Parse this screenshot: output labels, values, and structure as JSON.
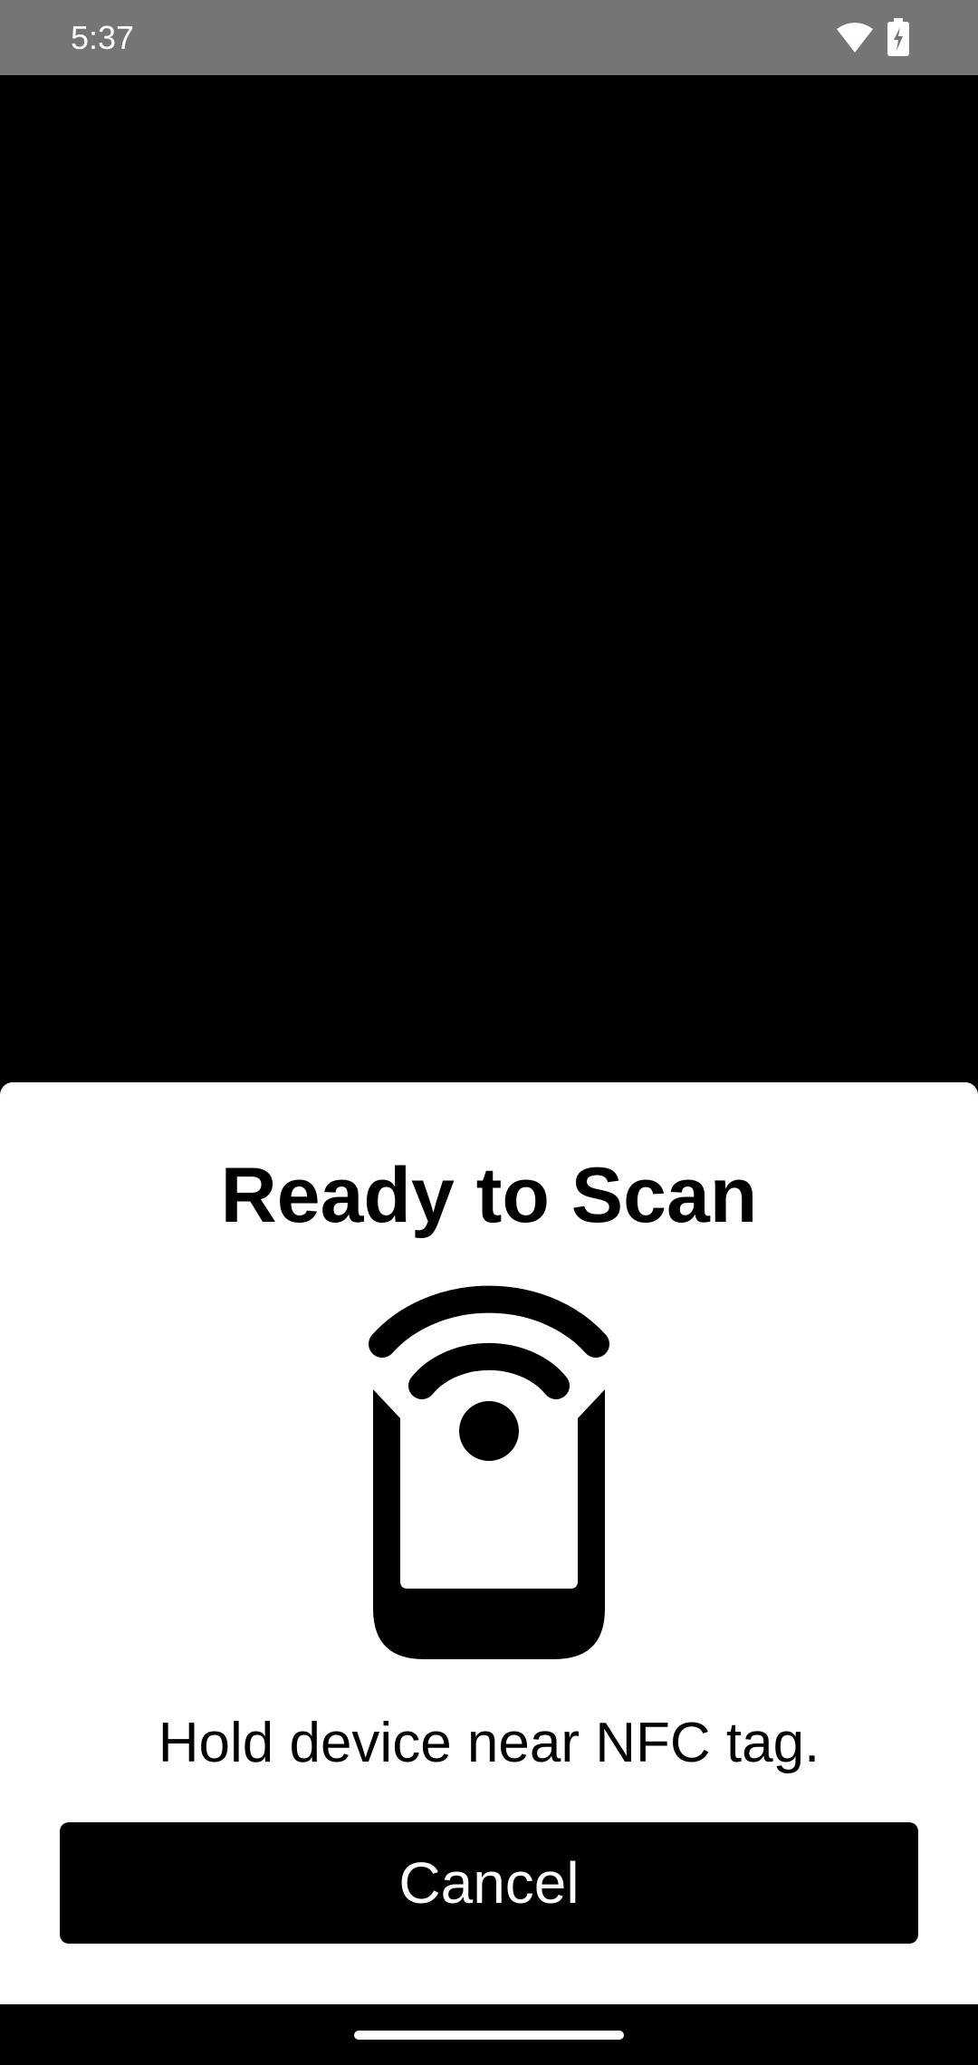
{
  "status_bar": {
    "time": "5:37",
    "icons": [
      "wifi-icon",
      "battery-charging-icon"
    ]
  },
  "sheet": {
    "title": "Ready to Scan",
    "icon": "nfc-phone-icon",
    "message": "Hold device near NFC tag.",
    "cancel_label": "Cancel"
  },
  "colors": {
    "status_bar_bg": "#757575",
    "app_bg": "#000000",
    "sheet_bg": "#ffffff",
    "button_bg": "#000000",
    "button_text": "#ffffff"
  }
}
